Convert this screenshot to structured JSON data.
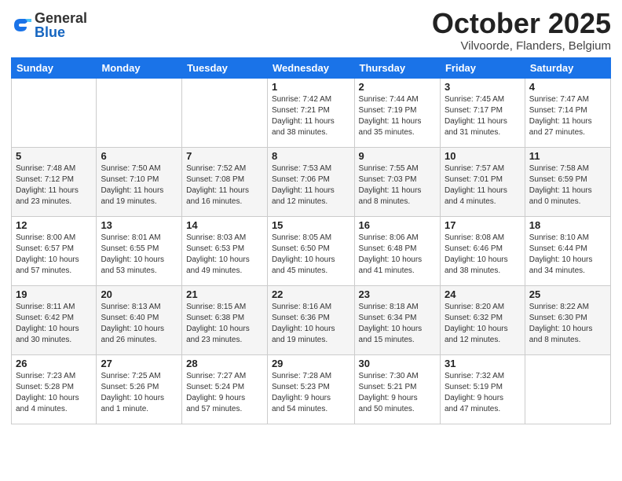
{
  "header": {
    "logo": {
      "general": "General",
      "blue": "Blue"
    },
    "title": "October 2025",
    "subtitle": "Vilvoorde, Flanders, Belgium"
  },
  "weekdays": [
    "Sunday",
    "Monday",
    "Tuesday",
    "Wednesday",
    "Thursday",
    "Friday",
    "Saturday"
  ],
  "weeks": [
    [
      {
        "day": "",
        "info": ""
      },
      {
        "day": "",
        "info": ""
      },
      {
        "day": "",
        "info": ""
      },
      {
        "day": "1",
        "info": "Sunrise: 7:42 AM\nSunset: 7:21 PM\nDaylight: 11 hours\nand 38 minutes."
      },
      {
        "day": "2",
        "info": "Sunrise: 7:44 AM\nSunset: 7:19 PM\nDaylight: 11 hours\nand 35 minutes."
      },
      {
        "day": "3",
        "info": "Sunrise: 7:45 AM\nSunset: 7:17 PM\nDaylight: 11 hours\nand 31 minutes."
      },
      {
        "day": "4",
        "info": "Sunrise: 7:47 AM\nSunset: 7:14 PM\nDaylight: 11 hours\nand 27 minutes."
      }
    ],
    [
      {
        "day": "5",
        "info": "Sunrise: 7:48 AM\nSunset: 7:12 PM\nDaylight: 11 hours\nand 23 minutes."
      },
      {
        "day": "6",
        "info": "Sunrise: 7:50 AM\nSunset: 7:10 PM\nDaylight: 11 hours\nand 19 minutes."
      },
      {
        "day": "7",
        "info": "Sunrise: 7:52 AM\nSunset: 7:08 PM\nDaylight: 11 hours\nand 16 minutes."
      },
      {
        "day": "8",
        "info": "Sunrise: 7:53 AM\nSunset: 7:06 PM\nDaylight: 11 hours\nand 12 minutes."
      },
      {
        "day": "9",
        "info": "Sunrise: 7:55 AM\nSunset: 7:03 PM\nDaylight: 11 hours\nand 8 minutes."
      },
      {
        "day": "10",
        "info": "Sunrise: 7:57 AM\nSunset: 7:01 PM\nDaylight: 11 hours\nand 4 minutes."
      },
      {
        "day": "11",
        "info": "Sunrise: 7:58 AM\nSunset: 6:59 PM\nDaylight: 11 hours\nand 0 minutes."
      }
    ],
    [
      {
        "day": "12",
        "info": "Sunrise: 8:00 AM\nSunset: 6:57 PM\nDaylight: 10 hours\nand 57 minutes."
      },
      {
        "day": "13",
        "info": "Sunrise: 8:01 AM\nSunset: 6:55 PM\nDaylight: 10 hours\nand 53 minutes."
      },
      {
        "day": "14",
        "info": "Sunrise: 8:03 AM\nSunset: 6:53 PM\nDaylight: 10 hours\nand 49 minutes."
      },
      {
        "day": "15",
        "info": "Sunrise: 8:05 AM\nSunset: 6:50 PM\nDaylight: 10 hours\nand 45 minutes."
      },
      {
        "day": "16",
        "info": "Sunrise: 8:06 AM\nSunset: 6:48 PM\nDaylight: 10 hours\nand 41 minutes."
      },
      {
        "day": "17",
        "info": "Sunrise: 8:08 AM\nSunset: 6:46 PM\nDaylight: 10 hours\nand 38 minutes."
      },
      {
        "day": "18",
        "info": "Sunrise: 8:10 AM\nSunset: 6:44 PM\nDaylight: 10 hours\nand 34 minutes."
      }
    ],
    [
      {
        "day": "19",
        "info": "Sunrise: 8:11 AM\nSunset: 6:42 PM\nDaylight: 10 hours\nand 30 minutes."
      },
      {
        "day": "20",
        "info": "Sunrise: 8:13 AM\nSunset: 6:40 PM\nDaylight: 10 hours\nand 26 minutes."
      },
      {
        "day": "21",
        "info": "Sunrise: 8:15 AM\nSunset: 6:38 PM\nDaylight: 10 hours\nand 23 minutes."
      },
      {
        "day": "22",
        "info": "Sunrise: 8:16 AM\nSunset: 6:36 PM\nDaylight: 10 hours\nand 19 minutes."
      },
      {
        "day": "23",
        "info": "Sunrise: 8:18 AM\nSunset: 6:34 PM\nDaylight: 10 hours\nand 15 minutes."
      },
      {
        "day": "24",
        "info": "Sunrise: 8:20 AM\nSunset: 6:32 PM\nDaylight: 10 hours\nand 12 minutes."
      },
      {
        "day": "25",
        "info": "Sunrise: 8:22 AM\nSunset: 6:30 PM\nDaylight: 10 hours\nand 8 minutes."
      }
    ],
    [
      {
        "day": "26",
        "info": "Sunrise: 7:23 AM\nSunset: 5:28 PM\nDaylight: 10 hours\nand 4 minutes."
      },
      {
        "day": "27",
        "info": "Sunrise: 7:25 AM\nSunset: 5:26 PM\nDaylight: 10 hours\nand 1 minute."
      },
      {
        "day": "28",
        "info": "Sunrise: 7:27 AM\nSunset: 5:24 PM\nDaylight: 9 hours\nand 57 minutes."
      },
      {
        "day": "29",
        "info": "Sunrise: 7:28 AM\nSunset: 5:23 PM\nDaylight: 9 hours\nand 54 minutes."
      },
      {
        "day": "30",
        "info": "Sunrise: 7:30 AM\nSunset: 5:21 PM\nDaylight: 9 hours\nand 50 minutes."
      },
      {
        "day": "31",
        "info": "Sunrise: 7:32 AM\nSunset: 5:19 PM\nDaylight: 9 hours\nand 47 minutes."
      },
      {
        "day": "",
        "info": ""
      }
    ]
  ]
}
